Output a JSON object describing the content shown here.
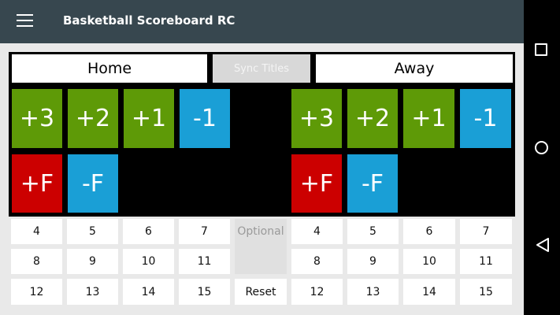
{
  "app_title": "Basketball Scoreboard RC",
  "home_title": "Home",
  "away_title": "Away",
  "sync_label": "Sync Titles",
  "home_buttons": {
    "plus3": "+3",
    "plus2": "+2",
    "plus1": "+1",
    "minus1": "-1",
    "plus_foul": "+F",
    "minus_foul": "-F"
  },
  "away_buttons": {
    "plus3": "+3",
    "plus2": "+2",
    "plus1": "+1",
    "minus1": "-1",
    "plus_foul": "+F",
    "minus_foul": "-F"
  },
  "home_numbers": [
    "4",
    "5",
    "6",
    "7",
    "8",
    "9",
    "10",
    "11",
    "12",
    "13",
    "14",
    "15"
  ],
  "away_numbers": [
    "4",
    "5",
    "6",
    "7",
    "8",
    "9",
    "10",
    "11",
    "12",
    "13",
    "14",
    "15"
  ],
  "optional_label": "Optional",
  "reset_label": "Reset",
  "colors": {
    "appbar": "#37474f",
    "green": "#5e9a07",
    "blue": "#1a9fd6",
    "red": "#cc0000"
  },
  "nav_icons": [
    "square-icon",
    "circle-icon",
    "back-triangle-icon"
  ]
}
